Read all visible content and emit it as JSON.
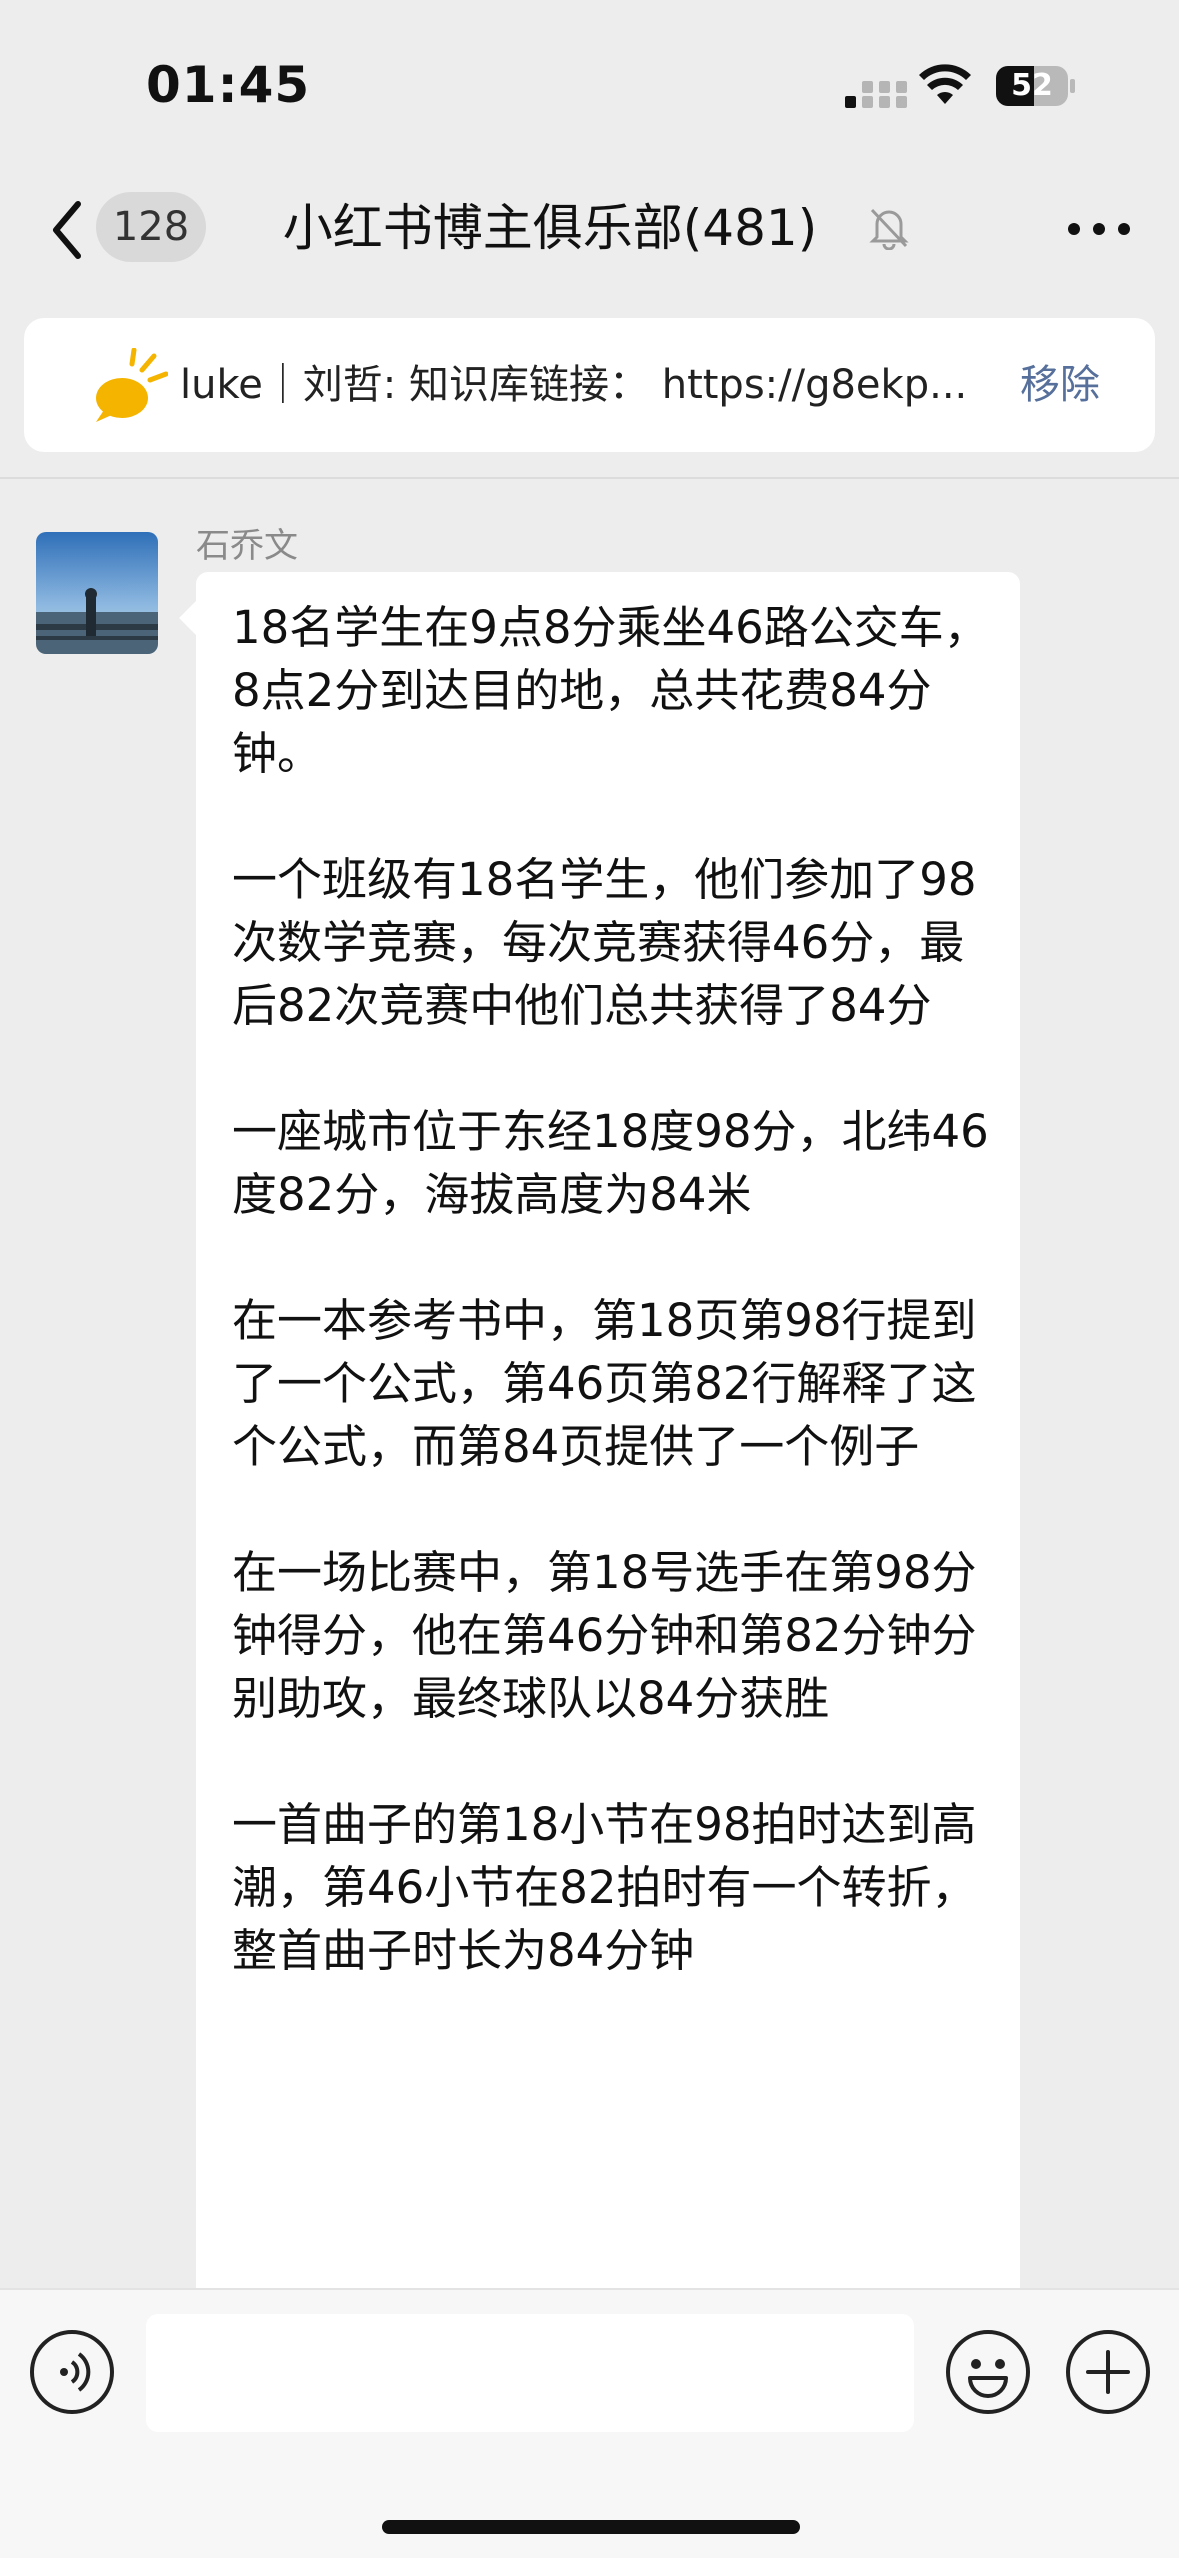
{
  "status_bar": {
    "time": "01:45",
    "battery_level": "52",
    "icons": [
      "signal-icon",
      "wifi-icon",
      "battery-icon"
    ]
  },
  "nav": {
    "back_icon": "chevron-left-icon",
    "unread_count": "128",
    "title": "小红书博主俱乐部(481)",
    "muted_icon": "bell-muted-icon",
    "more_icon": "more-dots-icon"
  },
  "pinned": {
    "icon": "announcement-icon",
    "text": "luke｜刘哲: 知识库链接： https://g8ekp...",
    "remove_label": "移除"
  },
  "message": {
    "sender": "石乔文",
    "body": "18名学生在9点8分乘坐46路公交车，8点2分到达目的地，总共花费84分钟。\n\n一个班级有18名学生，他们参加了98次数学竞赛，每次竞赛获得46分，最后82次竞赛中他们总共获得了84分\n\n一座城市位于东经18度98分，北纬46度82分，海拔高度为84米\n\n在一本参考书中，第18页第98行提到了一个公式，第46页第82行解释了这个公式，而第84页提供了一个例子\n\n在一场比赛中，第18号选手在第98分钟得分，他在第46分钟和第82分钟分别助攻，最终球队以84分获胜\n\n一首曲子的第18小节在98拍时达到高潮，第46小节在82拍时有一个转折，整首曲子时长为84分钟"
  },
  "input_bar": {
    "voice_icon": "voice-icon",
    "emoji_icon": "emoji-icon",
    "plus_icon": "plus-icon",
    "input_value": ""
  }
}
